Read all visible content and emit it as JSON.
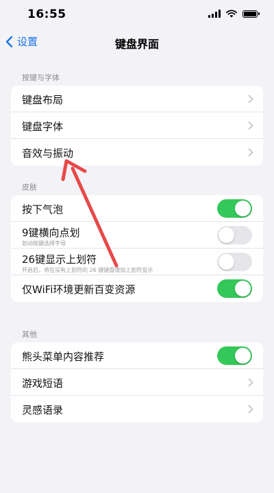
{
  "status": {
    "time": "16:55"
  },
  "nav": {
    "back_label": "设置",
    "title": "键盘界面"
  },
  "sections": {
    "keys_fonts": {
      "header": "按键与字体",
      "items": [
        {
          "label": "键盘布局"
        },
        {
          "label": "键盘字体"
        },
        {
          "label": "音效与振动"
        }
      ]
    },
    "skin": {
      "header": "皮肤",
      "items": [
        {
          "label": "按下气泡",
          "toggle": true
        },
        {
          "label": "9键横向点划",
          "sub": "划动按键选择字母",
          "toggle": false
        },
        {
          "label": "26键显示上划符",
          "sub": "开启后，将在没有上划符的 26 键键盘增加上划符显示",
          "toggle": false
        },
        {
          "label": "仅WiFi环境更新百变资源",
          "toggle": true
        }
      ]
    },
    "other": {
      "header": "其他",
      "items": [
        {
          "label": "熊头菜单内容推荐",
          "toggle": true
        },
        {
          "label": "游戏短语"
        },
        {
          "label": "灵感语录"
        }
      ]
    }
  },
  "colors": {
    "accent": "#1a73e8",
    "toggle_on": "#34c759",
    "annotation_arrow": "#e8494a"
  },
  "icons": [
    "back-chevron-icon",
    "chevron-right-icon",
    "signal-icon",
    "wifi-icon",
    "battery-icon"
  ]
}
